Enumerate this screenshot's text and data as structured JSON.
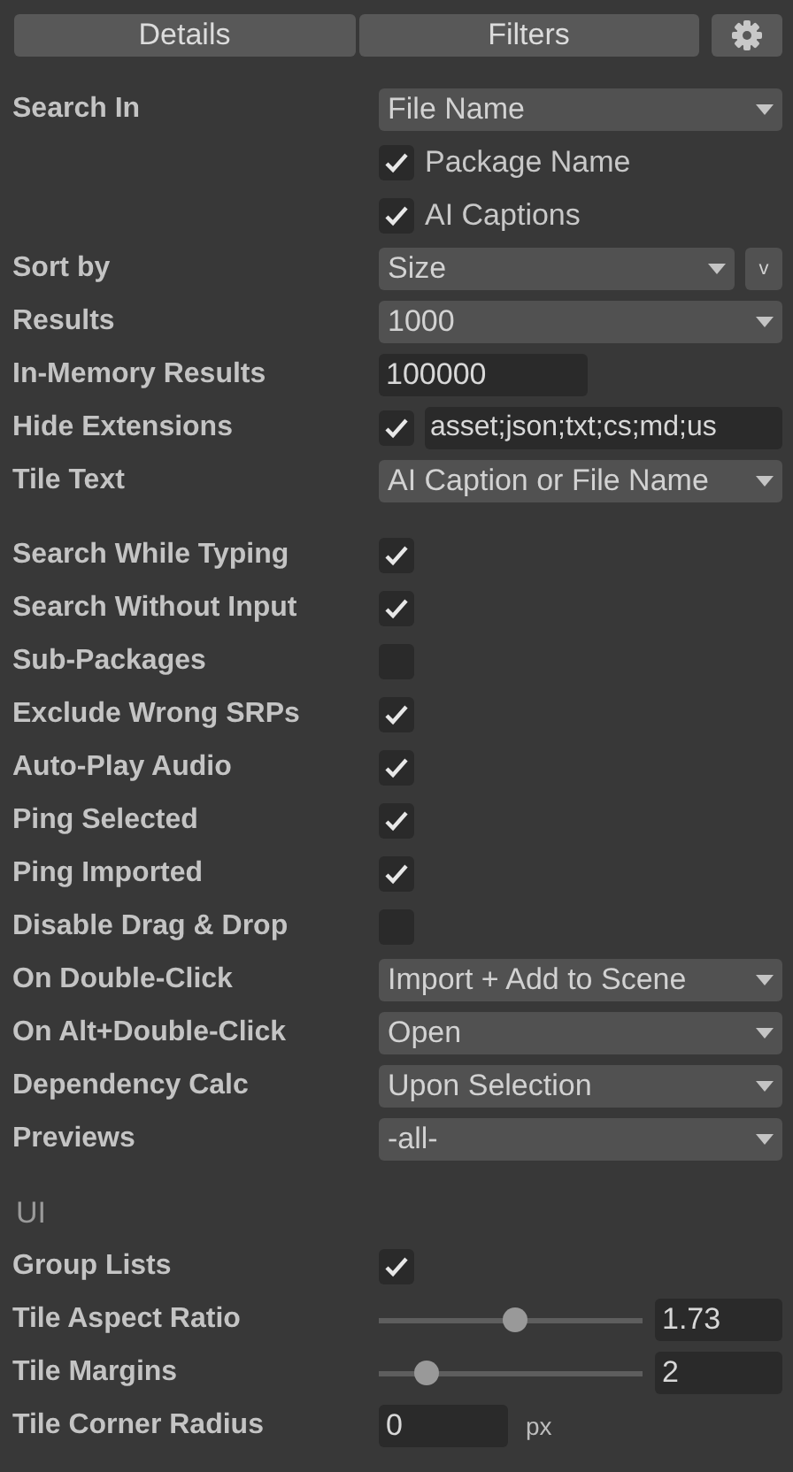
{
  "tabs": [
    {
      "label": "Details"
    },
    {
      "label": "Filters"
    }
  ],
  "groups": [
    {
      "rows": [
        {
          "kind": "dropdown",
          "label": "Search In",
          "value": "File Name"
        },
        {
          "kind": "option",
          "text": "Package Name",
          "checked": true
        },
        {
          "kind": "option",
          "text": "AI Captions",
          "checked": true
        },
        {
          "kind": "dropdown_toggle",
          "label": "Sort by",
          "value": "Size",
          "toggle": "v"
        },
        {
          "kind": "dropdown",
          "label": "Results",
          "value": "1000"
        },
        {
          "kind": "number",
          "label": "In-Memory Results",
          "value": "100000"
        },
        {
          "kind": "check_field",
          "label": "Hide Extensions",
          "checked": true,
          "value": "asset;json;txt;cs;md;us"
        },
        {
          "kind": "dropdown",
          "label": "Tile Text",
          "value": "AI Caption or File Name"
        }
      ]
    },
    {
      "rows": [
        {
          "kind": "checkbox",
          "label": "Search While Typing",
          "checked": true
        },
        {
          "kind": "checkbox",
          "label": "Search Without Input",
          "checked": true
        },
        {
          "kind": "checkbox",
          "label": "Sub-Packages",
          "checked": false
        },
        {
          "kind": "checkbox",
          "label": "Exclude Wrong SRPs",
          "checked": true
        },
        {
          "kind": "checkbox",
          "label": "Auto-Play Audio",
          "checked": true
        },
        {
          "kind": "checkbox",
          "label": "Ping Selected",
          "checked": true
        },
        {
          "kind": "checkbox",
          "label": "Ping Imported",
          "checked": true
        },
        {
          "kind": "checkbox",
          "label": "Disable Drag & Drop",
          "checked": false
        },
        {
          "kind": "dropdown",
          "label": "On Double-Click",
          "value": "Import + Add to Scene"
        },
        {
          "kind": "dropdown",
          "label": "On Alt+Double-Click",
          "value": "Open"
        },
        {
          "kind": "dropdown",
          "label": "Dependency Calc",
          "value": "Upon Selection"
        },
        {
          "kind": "dropdown",
          "label": "Previews",
          "value": "-all-"
        }
      ]
    },
    {
      "title": "UI",
      "rows": [
        {
          "kind": "checkbox",
          "label": "Group Lists",
          "checked": true
        },
        {
          "kind": "slider",
          "label": "Tile Aspect Ratio",
          "level": 0.52,
          "value": "1.73"
        },
        {
          "kind": "slider",
          "label": "Tile Margins",
          "level": 0.18,
          "value": "2"
        },
        {
          "kind": "number_unit",
          "label": "Tile Corner Radius",
          "value": "0",
          "unit": "px"
        }
      ]
    }
  ]
}
